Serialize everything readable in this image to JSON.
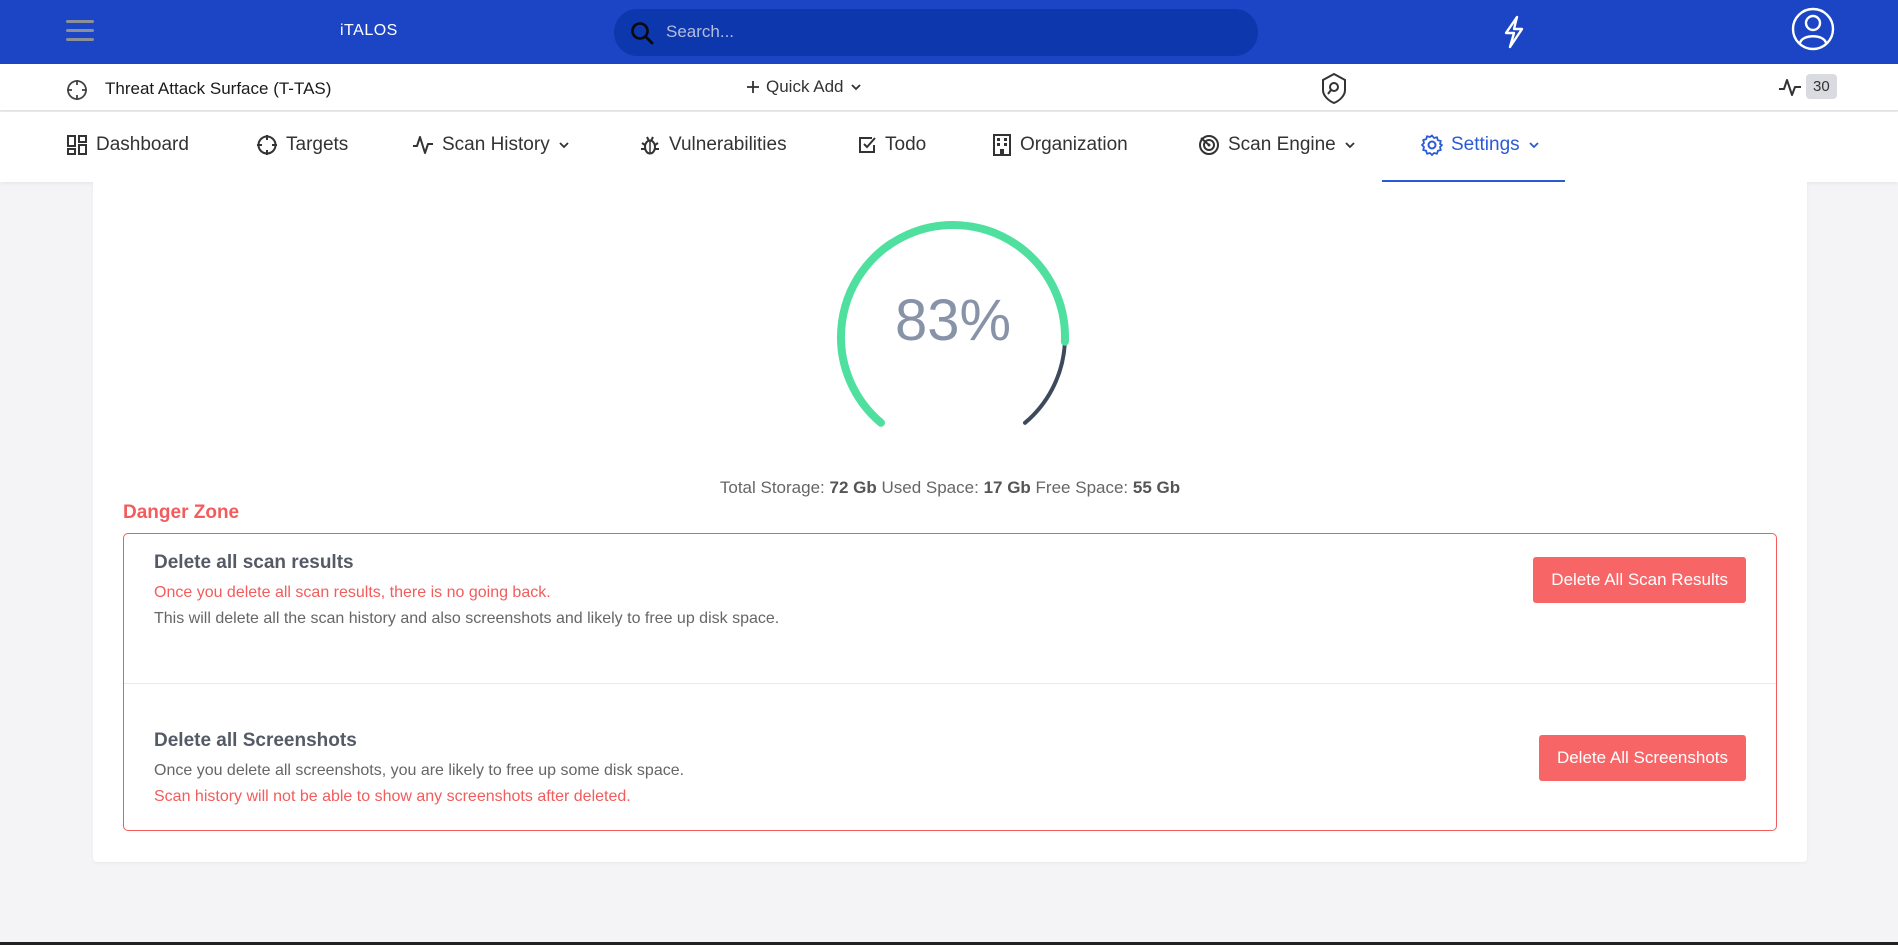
{
  "topbar": {
    "brand": "iTALOS",
    "search_placeholder": "Search...",
    "accent_color": "#1b45c4",
    "icons": [
      "hamburger-icon",
      "search-icon",
      "bolt-icon",
      "user-avatar-icon"
    ]
  },
  "subbar": {
    "project_name": "Threat Attack Surface (T-TAS)",
    "quick_add": "Quick Add",
    "activity_count": "30",
    "icons": [
      "crosshair-icon",
      "plus-icon",
      "chevron-down-icon",
      "shield-search-icon",
      "activity-icon"
    ]
  },
  "nav": {
    "items": [
      {
        "label": "Dashboard",
        "icon": "dashboard-icon"
      },
      {
        "label": "Targets",
        "icon": "crosshair-icon"
      },
      {
        "label": "Scan History",
        "icon": "activity-icon",
        "dropdown": true
      },
      {
        "label": "Vulnerabilities",
        "icon": "bug-icon"
      },
      {
        "label": "Todo",
        "icon": "checkbox-icon"
      },
      {
        "label": "Organization",
        "icon": "building-icon"
      },
      {
        "label": "Scan Engine",
        "icon": "radar-icon",
        "dropdown": true
      },
      {
        "label": "Settings",
        "icon": "gear-icon",
        "dropdown": true,
        "active": true
      }
    ]
  },
  "storage": {
    "used_percent_label": "83%",
    "used_fraction": 0.83,
    "total_label": "Total Storage:",
    "total_value": "72 Gb",
    "used_label": "Used Space:",
    "used_value": "17 Gb",
    "free_label": "Free Space:",
    "free_value": "55 Gb",
    "gauge_color": "#4fe0a0",
    "gauge_track_color": "#3d4a5c"
  },
  "danger_zone": {
    "title": "Danger Zone",
    "color": "#f25c5c",
    "sections": [
      {
        "title": "Delete all scan results",
        "warning": "Once you delete all scan results, there is no going back.",
        "description": "This will delete all the scan history and also screenshots and likely to free up disk space.",
        "button": "Delete All Scan Results"
      },
      {
        "title": "Delete all Screenshots",
        "description": "Once you delete all screenshots, you are likely to free up some disk space.",
        "warning": "Scan history will not be able to show any screenshots after deleted.",
        "button": "Delete All Screenshots"
      }
    ]
  }
}
